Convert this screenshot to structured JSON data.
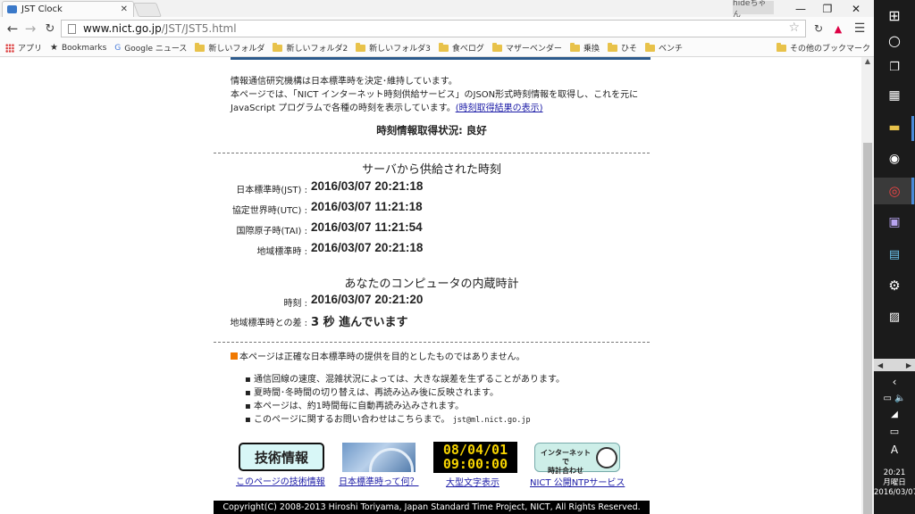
{
  "browser": {
    "tab_title": "JST Clock",
    "user": "hideちゃん",
    "url_host": "www.nict.go.jp",
    "url_path": "/JST/JST5.html",
    "bookmarks": [
      "アプリ",
      "Bookmarks",
      "Google ニュース",
      "新しいフォルダ",
      "新しいフォルダ2",
      "新しいフォルダ3",
      "食べログ",
      "マザーベンダー",
      "乗換",
      "ひそ",
      "ベンチ"
    ],
    "other_bookmarks": "その他のブックマーク"
  },
  "intro": {
    "line1": "情報通信研究機構は日本標準時を決定･維持しています。",
    "line2": "本ページでは、「NICT インターネット時刻供給サービス」のJSON形式時刻情報を取得し、これを元に",
    "line3": "JavaScript プログラムで各種の時刻を表示しています。",
    "line3_link": "(時刻取得結果の表示)"
  },
  "status": "時刻情報取得状況:  良好",
  "server": {
    "heading": "サーバから供給された時刻",
    "rows": [
      {
        "label": "日本標準時(JST) :",
        "value": "2016/03/07 20:21:18"
      },
      {
        "label": "協定世界時(UTC) :",
        "value": "2016/03/07 11:21:18"
      },
      {
        "label": "国際原子時(TAI) :",
        "value": "2016/03/07 11:21:54"
      },
      {
        "label": "地域標準時 :",
        "value": "2016/03/07 20:21:18"
      }
    ]
  },
  "local": {
    "heading": "あなたのコンピュータの内蔵時計",
    "time_label": "時刻 :",
    "time_value": "2016/03/07 20:21:20",
    "diff_label": "地域標準時との差 :",
    "diff_value": "3 秒 進んでいます"
  },
  "notice": "本ページは正確な日本標準時の提供を目的としたものではありません。",
  "bullets": [
    "通信回線の速度、混雑状況によっては、大きな誤差を生ずることがあります。",
    "夏時間･冬時間の切り替えは、再読み込み後に反映されます。",
    "本ページは、約1時間毎に自動再読み込みされます。",
    "このページに関するお問い合わせはこちらまで。"
  ],
  "contact_email": "jst@ml.nict.go.jp",
  "banners": [
    {
      "image_text": "技術情報",
      "caption": "このページの技術情報"
    },
    {
      "caption": "日本標準時って何？"
    },
    {
      "image_line1": "08/04/01",
      "image_line2": "09:00:00",
      "caption": "大型文字表示"
    },
    {
      "image_line1": "インターネットで",
      "image_line2": "時計合わせ",
      "caption": "NICT 公開NTPサービス"
    }
  ],
  "copyright": "Copyright(C) 2008-2013 Hiroshi Toriyama, Japan Standard Time Project, NICT, All Rights Reserved.",
  "taskbar": {
    "time": "20:21",
    "day": "月曜日",
    "date": "2016/03/07",
    "ime": "A"
  },
  "colors": {
    "accent_orange": "#f07800",
    "link": "#1a1aa6",
    "taskbar_bg": "#1b1b1b"
  }
}
